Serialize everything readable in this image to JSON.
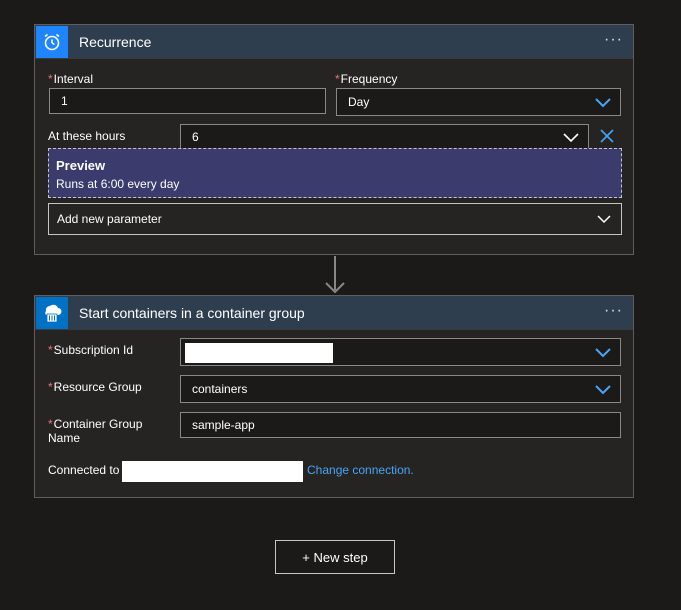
{
  "recurrence": {
    "title": "Recurrence",
    "more": "···",
    "interval_label": "Interval",
    "interval_value": "1",
    "frequency_label": "Frequency",
    "frequency_value": "Day",
    "hours_label": "At these hours",
    "hours_value": "6",
    "preview_title": "Preview",
    "preview_text": "Runs at 6:00 every day",
    "add_param_label": "Add new parameter"
  },
  "containers": {
    "title": "Start containers in a container group",
    "more": "···",
    "subscription_label": "Subscription Id",
    "resource_group_label": "Resource Group",
    "resource_group_value": "containers",
    "container_group_label_line1": "Container Group",
    "container_group_label_line2": "Name",
    "container_group_value": "sample-app",
    "connected_label": "Connected to",
    "change_connection": "Change connection."
  },
  "new_step": {
    "label": "+ New step"
  },
  "required_mark": "*",
  "colors": {
    "accent": "#1f85ff",
    "link": "#4aa3f5",
    "required": "#f1707b",
    "preview_bg": "#3b3b6d"
  }
}
